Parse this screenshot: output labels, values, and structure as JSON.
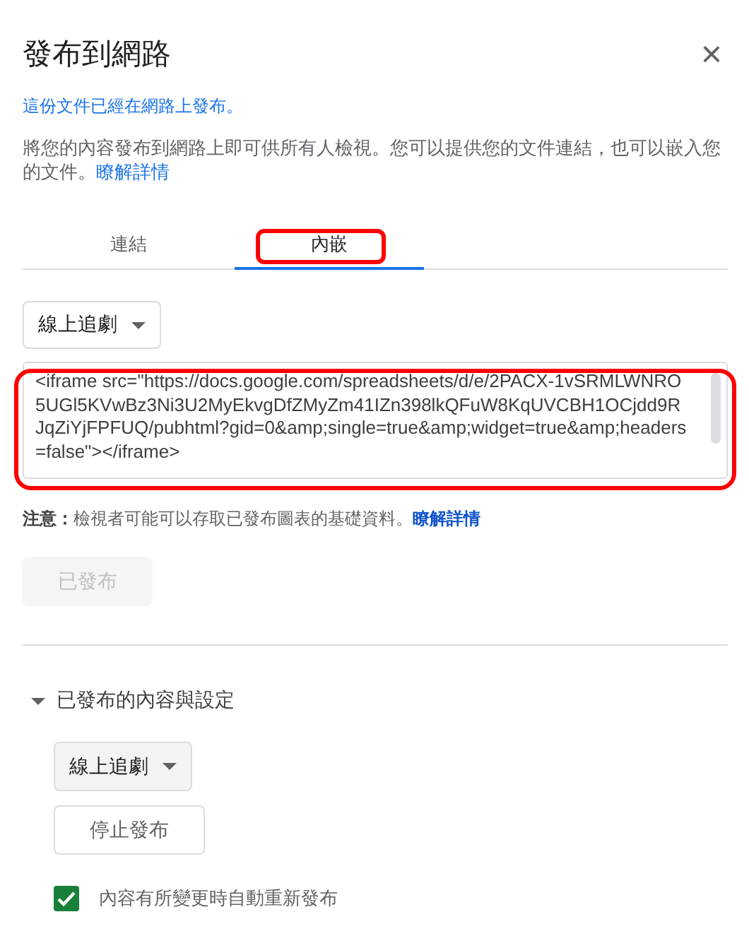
{
  "dialog": {
    "title": "發布到網路",
    "close": "×"
  },
  "status": "這份文件已經在網路上發布。",
  "description": {
    "text": "將您的內容發布到網路上即可供所有人檢視。您可以提供您的文件連結，也可以嵌入您的文件。",
    "link": "瞭解詳情"
  },
  "tabs": [
    {
      "label": "連結",
      "selected": false,
      "highlighted": false
    },
    {
      "label": "內嵌",
      "selected": true,
      "highlighted": true
    }
  ],
  "sheet_dropdown": {
    "value": "線上追劇"
  },
  "embed_code": {
    "value": "<iframe src=\"https://docs.google.com/spreadsheets/d/e/2PACX-1vSRMLWNRO5UGl5KVwBz3Ni3U2MyEkvgDfZMyZm41IZn398lkQFuW8KqUVCBH1OCjdd9RJqZiYjFPFUQ/pubhtml?gid=0&amp;single=true&amp;widget=true&amp;headers=false\"></iframe>",
    "highlighted": true
  },
  "note": {
    "text": "**注意：**檢視者可能可以存取已發布圖表的基礎資料。",
    "link": "瞭解詳情"
  },
  "publish_button": {
    "label": "已發布",
    "disabled": true
  },
  "published_settings": {
    "label": "已發布的內容與設定",
    "expanded": true,
    "dropdown": {
      "value": "線上追劇"
    },
    "stop_button": {
      "label": "停止發布"
    },
    "auto_republish": {
      "label": "內容有所變更時自動重新發布",
      "checked": true
    }
  }
}
